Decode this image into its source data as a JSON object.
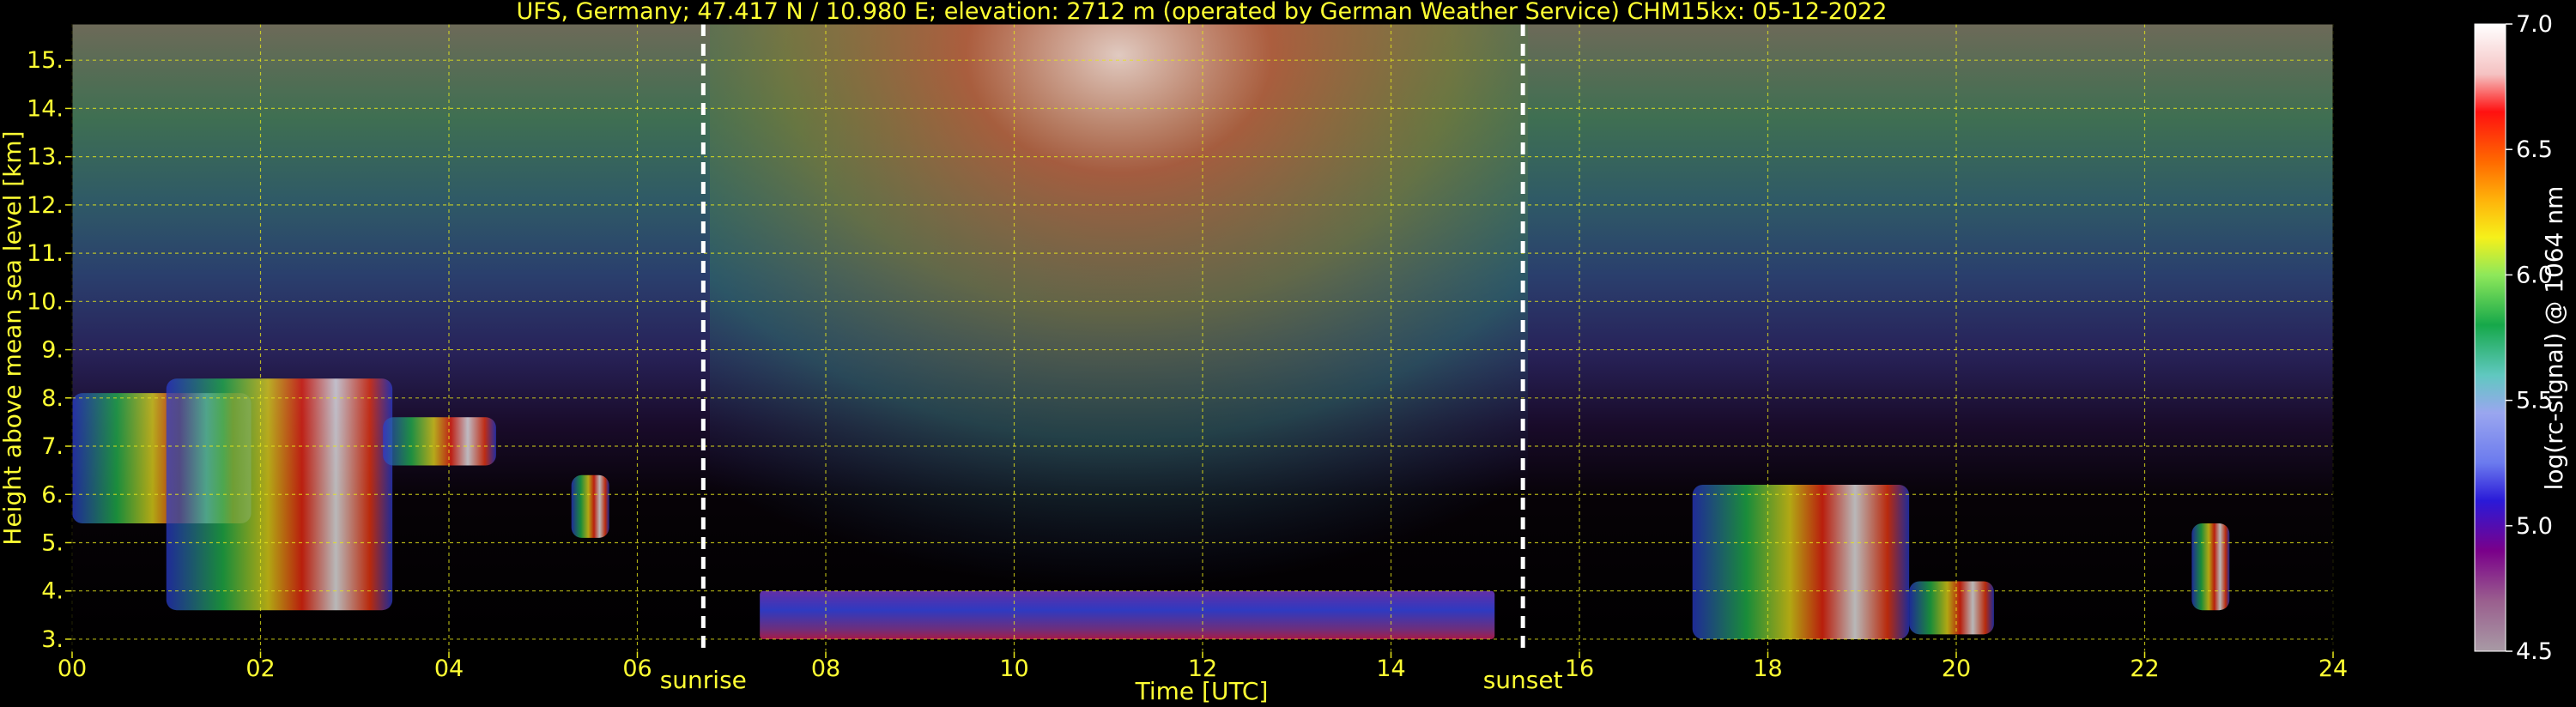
{
  "chart_data": {
    "type": "heatmap",
    "title": "UFS, Germany; 47.417 N / 10.980 E; elevation: 2712 m  (operated by German Weather Service)    CHM15kx: 05-12-2022",
    "xlabel": "Time [UTC]",
    "ylabel": "Height above mean sea level [km]",
    "xlim": [
      0,
      24
    ],
    "ylim": [
      2.75,
      15.75
    ],
    "x_ticks": [
      0,
      2,
      4,
      6,
      8,
      10,
      12,
      14,
      16,
      18,
      20,
      22,
      24
    ],
    "x_tick_labels": [
      "00",
      "02",
      "04",
      "06",
      "08",
      "10",
      "12",
      "14",
      "16",
      "18",
      "20",
      "22",
      "24"
    ],
    "y_ticks": [
      3,
      4,
      5,
      6,
      7,
      8,
      9,
      10,
      11,
      12,
      13,
      14,
      15
    ],
    "y_tick_labels": [
      "3.",
      "4.",
      "5.",
      "6.",
      "7.",
      "8.",
      "9.",
      "10.",
      "11.",
      "12.",
      "13.",
      "14.",
      "15."
    ],
    "grid": true,
    "annotations": [
      {
        "label": "sunrise",
        "x": 6.7
      },
      {
        "label": "sunset",
        "x": 15.4
      }
    ],
    "colorbar": {
      "label": "log(rc-signal) @ 1064 nm",
      "range": [
        4.5,
        7.0
      ],
      "ticks": [
        4.5,
        5.0,
        5.5,
        6.0,
        6.5,
        7.0
      ],
      "tick_labels": [
        "4.5",
        "5.0",
        "5.5",
        "6.0",
        "6.5",
        "7.0"
      ]
    },
    "features": [
      {
        "type": "cloud",
        "x0": 0.0,
        "x1": 1.9,
        "y_top": 8.1,
        "y_bottom": 5.4
      },
      {
        "type": "cloud",
        "x0": 1.0,
        "x1": 3.4,
        "y_top": 8.4,
        "y_bottom": 3.6
      },
      {
        "type": "cloud",
        "x0": 3.3,
        "x1": 4.5,
        "y_top": 7.6,
        "y_bottom": 6.6
      },
      {
        "type": "cloud",
        "x0": 5.3,
        "x1": 5.7,
        "y_top": 6.4,
        "y_bottom": 5.1
      },
      {
        "type": "boundary_layer",
        "x0": 7.3,
        "x1": 15.1,
        "y_top": 4.0,
        "y_bottom": 3.0
      },
      {
        "type": "cloud",
        "x0": 17.2,
        "x1": 19.5,
        "y_top": 6.2,
        "y_bottom": 3.0
      },
      {
        "type": "cloud",
        "x0": 19.5,
        "x1": 20.4,
        "y_top": 4.2,
        "y_bottom": 3.1
      },
      {
        "type": "cloud",
        "x0": 22.5,
        "x1": 22.9,
        "y_top": 5.4,
        "y_bottom": 3.6
      }
    ]
  }
}
